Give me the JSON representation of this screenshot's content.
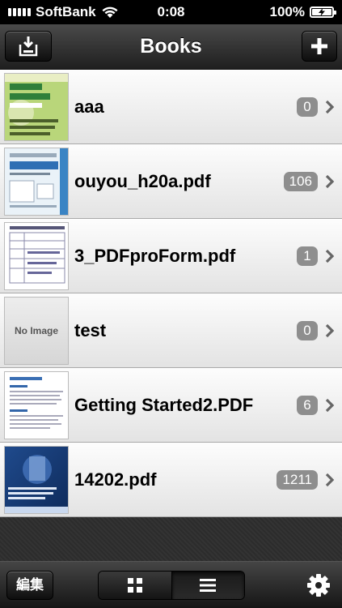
{
  "status_bar": {
    "carrier": "SoftBank",
    "time": "0:08",
    "battery_percent": "100%",
    "icons": [
      "signal-icon",
      "wifi-icon",
      "battery-icon"
    ]
  },
  "nav_bar": {
    "title": "Books",
    "left_button_icon": "download-icon",
    "right_button_icon": "plus-icon"
  },
  "books": [
    {
      "title": "aaa",
      "count": "0",
      "thumb": "green-book-cover"
    },
    {
      "title": "ouyou_h20a.pdf",
      "count": "106",
      "thumb": "blue-book-cover"
    },
    {
      "title": "3_PDFproForm.pdf",
      "count": "1",
      "thumb": "form-document"
    },
    {
      "title": "test",
      "count": "0",
      "thumb": "no-image",
      "thumb_text": "No Image"
    },
    {
      "title": "Getting Started2.PDF",
      "count": "6",
      "thumb": "text-document"
    },
    {
      "title": "14202.pdf",
      "count": "1211",
      "thumb": "iis-book-cover"
    }
  ],
  "toolbar": {
    "edit_label": "編集",
    "grid_icon": "grid-icon",
    "list_icon": "list-icon",
    "settings_icon": "gear-icon"
  },
  "colors": {
    "badge": "#8e8e8e",
    "bar_dark": "#1f1f1f",
    "row_light": "#fdfdfd"
  }
}
